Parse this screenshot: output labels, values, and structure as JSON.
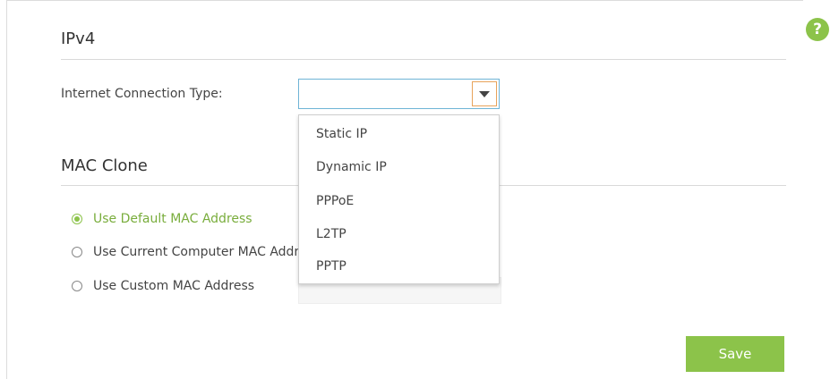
{
  "help_icon_glyph": "?",
  "ipv4": {
    "title": "IPv4",
    "connection_type_label": "Internet Connection Type:",
    "connection_type_value": "",
    "connection_type_options": [
      "Static IP",
      "Dynamic IP",
      "PPPoE",
      "L2TP",
      "PPTP"
    ]
  },
  "mac_clone": {
    "title": "MAC Clone",
    "options": [
      {
        "label": "Use Default MAC Address",
        "selected": true
      },
      {
        "label": "Use Current Computer MAC Address",
        "selected": false
      },
      {
        "label": "Use Custom MAC Address",
        "selected": false
      }
    ]
  },
  "save_label": "Save",
  "colors": {
    "accent": "#8cc34a",
    "focus_border": "#6fb4d6",
    "arrow_border": "#e8a35a"
  }
}
